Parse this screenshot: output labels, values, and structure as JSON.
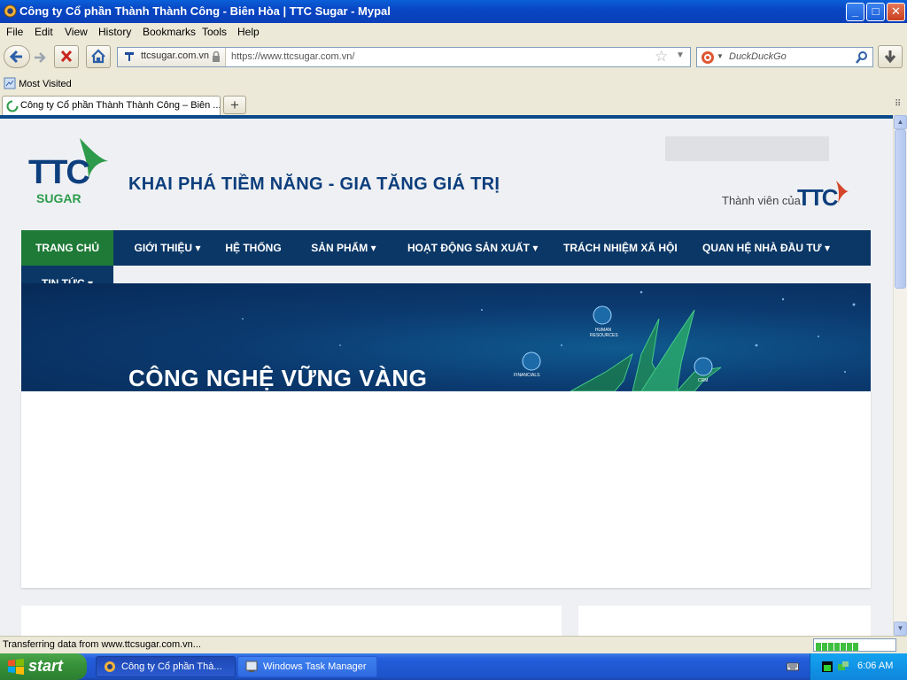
{
  "window": {
    "title": "Công ty Cổ phần Thành Thành Công - Biên Hòa | TTC Sugar - Mypal",
    "controls": {
      "minimize": "_",
      "maximize": "□",
      "close": "✕"
    }
  },
  "menu": [
    "File",
    "Edit",
    "View",
    "History",
    "Bookmarks",
    "Tools",
    "Help"
  ],
  "navbar": {
    "site_identity": "ttcsugar.com.vn",
    "url": "https://www.ttcsugar.com.vn/",
    "search_placeholder": "DuckDuckGo"
  },
  "bookmarks": {
    "most_visited": "Most Visited"
  },
  "tabs": [
    {
      "title": "Công ty Cổ phần Thành Thành Công – Biên ..."
    }
  ],
  "page": {
    "logo": {
      "letters": "TTC",
      "sub": "SUGAR"
    },
    "slogan": "KHAI PHÁ TIỀM NĂNG - GIA TĂNG GIÁ TRỊ",
    "member_of": "Thành viên của",
    "member_logo": "TTC",
    "nav": [
      {
        "label": "TRANG CHỦ",
        "active": true,
        "dropdown": false
      },
      {
        "label": "GIỚI THIỆU",
        "dropdown": true
      },
      {
        "label": "HỆ THỐNG",
        "dropdown": false
      },
      {
        "label": "SẢN PHẨM",
        "dropdown": true
      },
      {
        "label": "HOẠT ĐỘNG SẢN XUẤT",
        "dropdown": true
      },
      {
        "label": "TRÁCH NHIỆM XÃ HỘI",
        "dropdown": false
      },
      {
        "label": "QUAN HỆ NHÀ ĐẦU TƯ",
        "dropdown": true
      },
      {
        "label": "TIN TỨC",
        "dropdown": true
      }
    ],
    "banner": {
      "headline": "CÔNG NGHỆ VỮNG VÀNG",
      "icon_labels": [
        "HUMAN RESOURCES",
        "FINANCIALS",
        "CRM"
      ]
    }
  },
  "status": {
    "text": "Transferring data from www.ttcsugar.com.vn...",
    "progress": 0.6
  },
  "taskbar": {
    "start": "start",
    "tasks": [
      "Công ty Cổ phần Thà...",
      "Windows Task Manager"
    ],
    "clock": "6:06 AM"
  },
  "colors": {
    "nav_bg": "#0b3766",
    "nav_active": "#1e7a36",
    "brand_blue": "#0d3e7d",
    "brand_green": "#2d9b4b"
  }
}
